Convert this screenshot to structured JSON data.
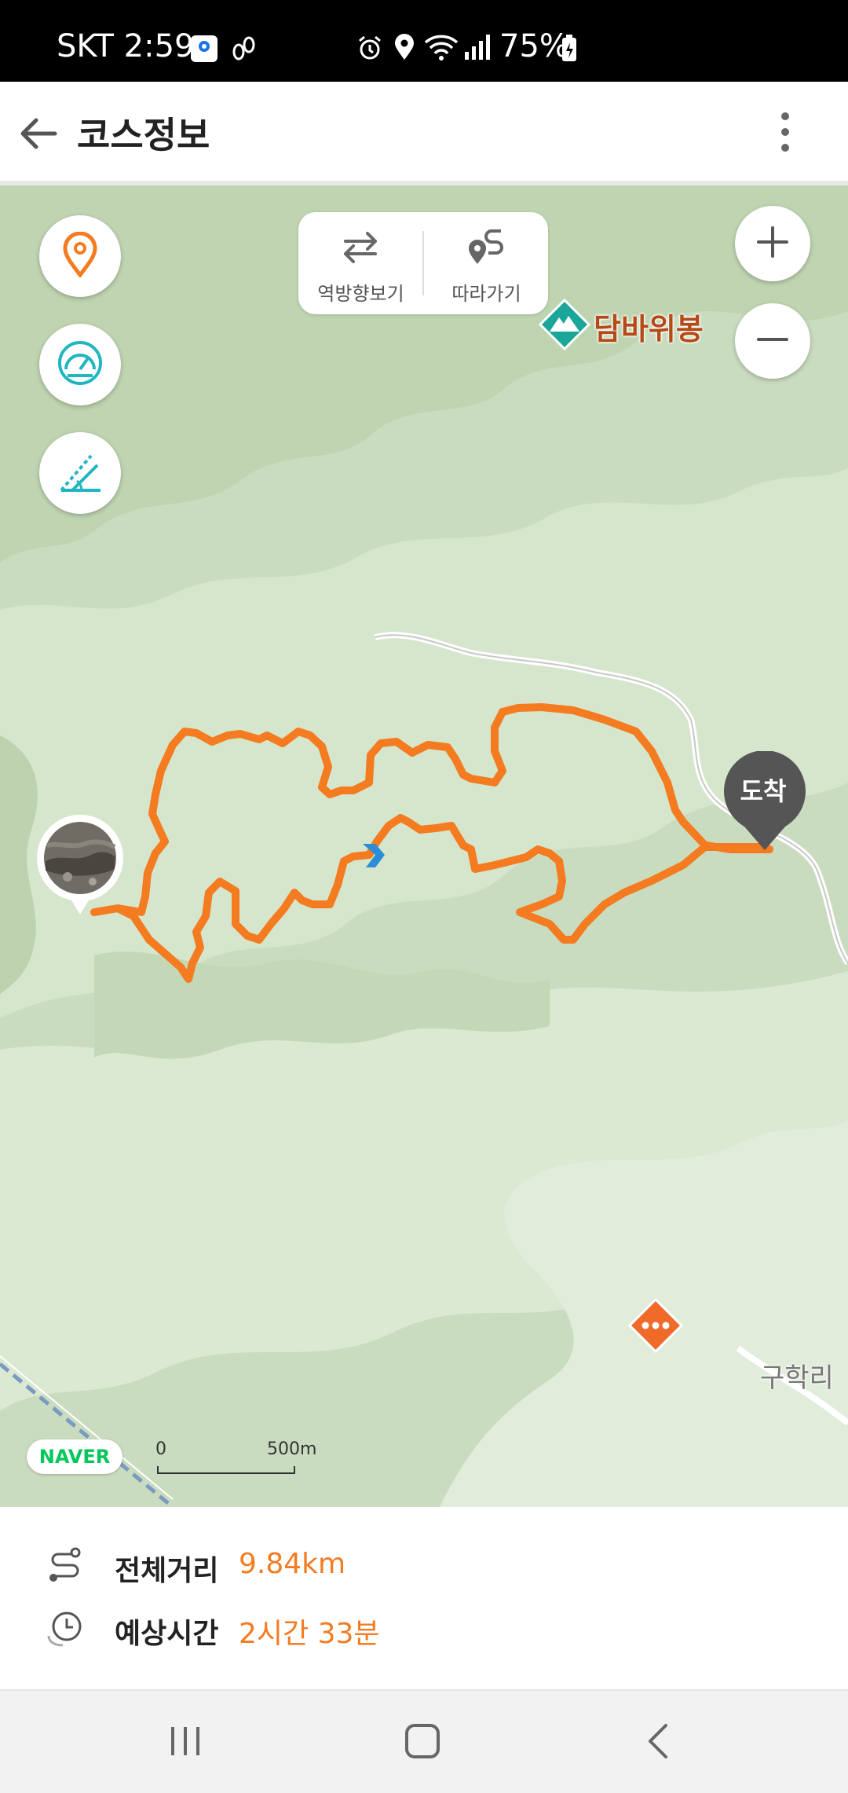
{
  "status_bar": {
    "carrier_time": "SKT 2:59",
    "battery": "75%",
    "icons": [
      "photo-app-icon",
      "footprints-icon",
      "alarm-icon",
      "location-icon",
      "wifi-icon",
      "signal-icon",
      "battery-charging-icon"
    ]
  },
  "app_bar": {
    "title": "코스정보",
    "back_icon": "arrow-left-icon",
    "menu_icon": "more-vertical-icon"
  },
  "map": {
    "route_controls": {
      "reverse_label": "역방향보기",
      "follow_label": "따라가기"
    },
    "peak_name": "담바위봉",
    "village_name": "구학리",
    "arrive_label": "도착",
    "naver_logo": "NAVER",
    "scale": {
      "zero": "0",
      "distance": "500m"
    },
    "route_color": "#f47b20",
    "side_buttons": [
      "location-pin-icon",
      "speedometer-icon",
      "slope-icon"
    ],
    "zoom_buttons": [
      "zoom-in-icon",
      "zoom-out-icon"
    ]
  },
  "info": {
    "distance_label": "전체거리",
    "distance_value": "9.84km",
    "time_label": "예상시간",
    "time_value": "2시간 33분"
  },
  "nav_bar": [
    "recent-apps-icon",
    "home-icon",
    "back-icon"
  ]
}
